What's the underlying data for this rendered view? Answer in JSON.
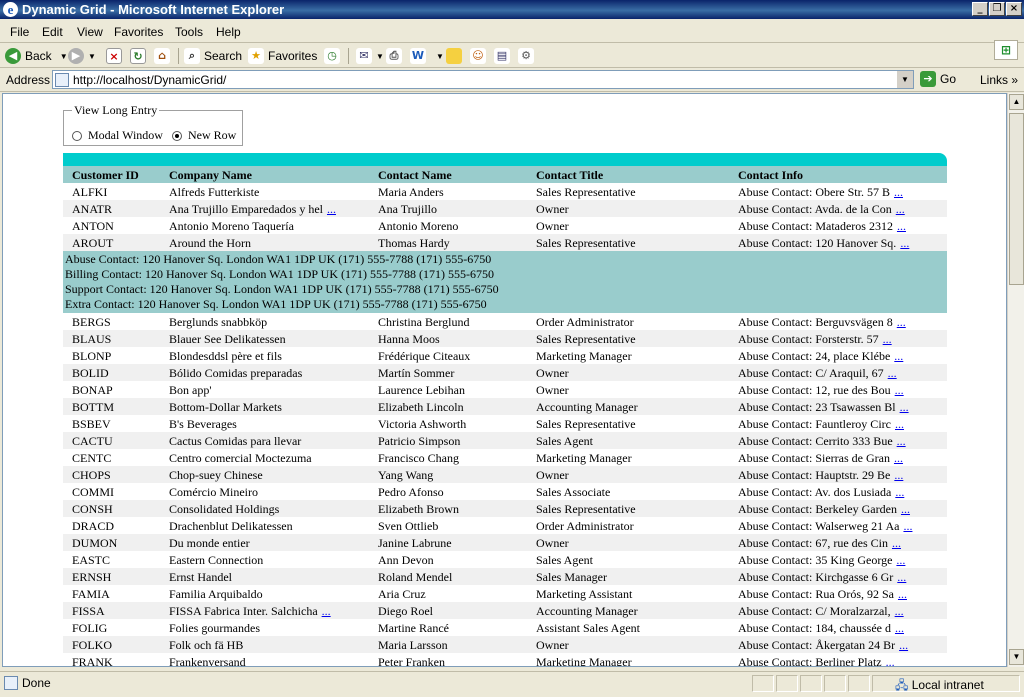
{
  "window": {
    "title": "Dynamic Grid - Microsoft Internet Explorer"
  },
  "menu": [
    "File",
    "Edit",
    "View",
    "Favorites",
    "Tools",
    "Help"
  ],
  "toolbar": {
    "back": "Back",
    "search": "Search",
    "favorites": "Favorites"
  },
  "address": {
    "label": "Address",
    "url": "http://localhost/DynamicGrid/",
    "go": "Go",
    "links": "Links"
  },
  "status": {
    "text": "Done",
    "zone": "Local intranet"
  },
  "view_option": {
    "legend": "View Long Entry",
    "modal": "Modal Window",
    "new_row": "New Row",
    "selected": "New Row"
  },
  "grid": {
    "headers": [
      "Customer ID",
      "Company Name",
      "Contact Name",
      "Contact Title",
      "Contact Info"
    ],
    "more_label": "...",
    "rows_before": [
      [
        "ALFKI",
        "Alfreds Futterkiste",
        "Maria Anders",
        "Sales Representative",
        "Abuse Contact: Obere Str. 57 B"
      ],
      [
        "ANATR",
        "Ana Trujillo Emparedados y hel",
        "Ana Trujillo",
        "Owner",
        "Abuse Contact: Avda. de la Con"
      ],
      [
        "ANTON",
        "Antonio Moreno Taquería",
        "Antonio Moreno",
        "Owner",
        "Abuse Contact: Mataderos 2312"
      ],
      [
        "AROUT",
        "Around the Horn",
        "Thomas Hardy",
        "Sales Representative",
        "Abuse Contact: 120 Hanover Sq."
      ]
    ],
    "company_truncated": [
      "ANATR"
    ],
    "detail_lines": [
      "Abuse Contact: 120 Hanover Sq. London WA1 1DP UK (171) 555-7788 (171) 555-6750",
      "Billing Contact: 120 Hanover Sq. London WA1 1DP UK (171) 555-7788 (171) 555-6750",
      "Support Contact: 120 Hanover Sq. London WA1 1DP UK (171) 555-7788 (171) 555-6750",
      "Extra Contact: 120 Hanover Sq. London WA1 1DP UK (171) 555-7788 (171) 555-6750"
    ],
    "rows_after": [
      [
        "BERGS",
        "Berglunds snabbköp",
        "Christina Berglund",
        "Order Administrator",
        "Abuse Contact: Berguvsvägen 8"
      ],
      [
        "BLAUS",
        "Blauer See Delikatessen",
        "Hanna Moos",
        "Sales Representative",
        "Abuse Contact: Forsterstr. 57"
      ],
      [
        "BLONP",
        "Blondesddsl père et fils",
        "Frédérique Citeaux",
        "Marketing Manager",
        "Abuse Contact: 24, place Klébe"
      ],
      [
        "BOLID",
        "Bólido Comidas preparadas",
        "Martín Sommer",
        "Owner",
        "Abuse Contact: C/ Araquil, 67"
      ],
      [
        "BONAP",
        "Bon app'",
        "Laurence Lebihan",
        "Owner",
        "Abuse Contact: 12, rue des Bou"
      ],
      [
        "BOTTM",
        "Bottom-Dollar Markets",
        "Elizabeth Lincoln",
        "Accounting Manager",
        "Abuse Contact: 23 Tsawassen Bl"
      ],
      [
        "BSBEV",
        "B's Beverages",
        "Victoria Ashworth",
        "Sales Representative",
        "Abuse Contact: Fauntleroy Circ"
      ],
      [
        "CACTU",
        "Cactus Comidas para llevar",
        "Patricio Simpson",
        "Sales Agent",
        "Abuse Contact: Cerrito 333 Bue"
      ],
      [
        "CENTC",
        "Centro comercial Moctezuma",
        "Francisco Chang",
        "Marketing Manager",
        "Abuse Contact: Sierras de Gran"
      ],
      [
        "CHOPS",
        "Chop-suey Chinese",
        "Yang Wang",
        "Owner",
        "Abuse Contact: Hauptstr. 29 Be"
      ],
      [
        "COMMI",
        "Comércio Mineiro",
        "Pedro Afonso",
        "Sales Associate",
        "Abuse Contact: Av. dos Lusiada"
      ],
      [
        "CONSH",
        "Consolidated Holdings",
        "Elizabeth Brown",
        "Sales Representative",
        "Abuse Contact: Berkeley Garden"
      ],
      [
        "DRACD",
        "Drachenblut Delikatessen",
        "Sven Ottlieb",
        "Order Administrator",
        "Abuse Contact: Walserweg 21 Aa"
      ],
      [
        "DUMON",
        "Du monde entier",
        "Janine Labrune",
        "Owner",
        "Abuse Contact: 67, rue des Cin"
      ],
      [
        "EASTC",
        "Eastern Connection",
        "Ann Devon",
        "Sales Agent",
        "Abuse Contact: 35 King George"
      ],
      [
        "ERNSH",
        "Ernst Handel",
        "Roland Mendel",
        "Sales Manager",
        "Abuse Contact: Kirchgasse 6 Gr"
      ],
      [
        "FAMIA",
        "Familia Arquibaldo",
        "Aria Cruz",
        "Marketing Assistant",
        "Abuse Contact: Rua Orós, 92 Sa"
      ],
      [
        "FISSA",
        "FISSA Fabrica Inter. Salchicha",
        "Diego Roel",
        "Accounting Manager",
        "Abuse Contact: C/ Moralzarzal,"
      ],
      [
        "FOLIG",
        "Folies gourmandes",
        "Martine Rancé",
        "Assistant Sales Agent",
        "Abuse Contact: 184, chaussée d"
      ],
      [
        "FOLKO",
        "Folk och fä HB",
        "Maria Larsson",
        "Owner",
        "Abuse Contact: Åkergatan 24 Br"
      ],
      [
        "FRANK",
        "Frankenversand",
        "Peter Franken",
        "Marketing Manager",
        "Abuse Contact: Berliner Platz"
      ]
    ],
    "company_truncated_after": [
      "FISSA"
    ]
  }
}
